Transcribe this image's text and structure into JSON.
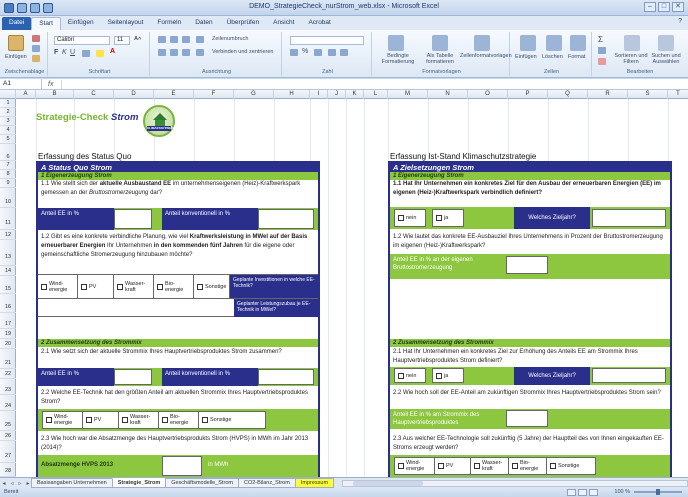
{
  "window": {
    "title": "DEMO_StrategieCheck_nurStrom_web.xlsx - Microsoft Excel",
    "minimize": "–",
    "maximize": "□",
    "close": "✕"
  },
  "ribbon_tabs": [
    "Datei",
    "Start",
    "Einfügen",
    "Seitenlayout",
    "Formeln",
    "Daten",
    "Überprüfen",
    "Ansicht",
    "Acrobat"
  ],
  "ribbon": {
    "paste_label": "Einfügen",
    "font_name": "Calibri",
    "font_size": "11",
    "groups": [
      "Zwischenablage",
      "Schriftart",
      "Ausrichtung",
      "Zahl",
      "Formatvorlagen",
      "Zellen",
      "Bearbeiten"
    ],
    "wrap_text": "Zeilenumbruch",
    "merge_center": "Verbinden und zentrieren",
    "cond_format": "Bedingte Formatierung",
    "as_table": "Als Tabelle formatieren",
    "cell_styles": "Zellenformatvorlagen",
    "insert": "Einfügen",
    "delete": "Löschen",
    "format": "Format",
    "sort_filter": "Sortieren und Filtern",
    "find_select": "Suchen und Auswählen"
  },
  "formula_bar": {
    "name_box": "A1",
    "fx": "fx",
    "value": ""
  },
  "columns": [
    "A",
    "B",
    "C",
    "D",
    "E",
    "F",
    "G",
    "H",
    "I",
    "J",
    "K",
    "L",
    "M",
    "N",
    "O",
    "P",
    "Q",
    "R",
    "S",
    "T"
  ],
  "rows": [
    "1",
    "2",
    "3",
    "4",
    "5",
    "6",
    "7",
    "8",
    "9",
    "10",
    "11",
    "12",
    "13",
    "14",
    "15",
    "16",
    "17",
    "19",
    "20",
    "21",
    "22",
    "23",
    "24",
    "25",
    "26",
    "27",
    "28"
  ],
  "sheet": {
    "title_main": "Strategie-Check ",
    "title_strom": "Strom",
    "logo_text": "KLIMASTADTWERK",
    "left": {
      "section_title": "Erfassung des Status Quo",
      "panel_title": "A Status Quo Strom",
      "g1": "1 Eigenerzeugung Strom",
      "q11_a": "1.1 Wie stellt sich der ",
      "q11_b": "aktuelle Ausbaustand EE",
      "q11_c": " im unternehmenseigenen (Heiz)-Kraftwerkspark gemessen an der ",
      "q11_d": "Bruttostromerzeugung",
      "q11_e": " dar?",
      "anteil_ee": "Anteil EE in %",
      "anteil_konv": "Anteil konventionell in %",
      "q12_a": "1.2 Gibt es eine konkrete verbindliche Planung, wie viel ",
      "q12_b": "Kraftwerksleistung in MWel auf der Basis erneuerbarer Energien",
      "q12_c": " Ihr Unternehmen ",
      "q12_d": "in den kommenden fünf Jahren",
      "q12_e": " für die eigene oder gemeinschaftliche Stromerzeugung hinzubauen möchte?",
      "checks": [
        "Wind-energie",
        "PV",
        "Wasser-kraft",
        "Bio-energie",
        "Sonstige"
      ],
      "planned_invest": "Geplante Investitionen in welche EE-Technik?",
      "planned_capacity": "Geplanter Leistungszubau je EE-Technik in MWel?",
      "g2": "2 Zusammensetzung des Strommix",
      "q21": "2.1 Wie setzt sich der aktuelle Strommix Ihres Hauptvertriebsproduktes Strom zusammen?",
      "q22": "2.2 Welche EE-Technik hat den größten Anteil am aktuellen Strommix Ihres Hauptvertriebsproduktes Strom?",
      "q23": "2.3 Wie hoch war die Absatzmenge des Hauptvertriebsprodukts Strom (HVPS) in MWh im Jahr 2013 (2014)?",
      "absatz_label": "Absatzmenge HVPS 2013",
      "unit_mwh": "in MWh"
    },
    "right": {
      "section_title": "Erfassung Ist-Stand Klimaschutzstrategie",
      "panel_title": "A Zielsetzungen Strom",
      "g1": "1 Eigenerzeugung Strom",
      "q11": "1.1 Hat Ihr Unternehmen ein konkretes Ziel für den Ausbau der erneuerbaren Energien (EE) im eigenen (Heiz-)Kraftwerkspark verbindlich definiert?",
      "nein": "nein",
      "ja": "ja",
      "which_year": "Welches Zieljahr?",
      "q12": "1.2 Wie lautet das konkrete EE-Ausbauziel Ihres Unternehmens in Prozent der Bruttostromerzeugung im eigenen (Heiz-)Kraftwerkspark?",
      "anteil_ee_own": "Anteil EE in % an der eigenen Bruttostromerzeugung",
      "g2": "2 Zusammensetzung des Strommix",
      "q21": "2.1 Hat Ihr Unternehmen ein konkretes Ziel zur Erhöhung des Anteils EE am Strommix Ihres Hauptvertriebsproduktes Strom definiert?",
      "q22": "2.2 Wie hoch soll der EE-Anteil am zukünftigen Strommix Ihres Hauptvertriebsproduktes Strom sein?",
      "anteil_ee_mix": "Anteil EE in % am Strommix des Hauptvertriebsproduktes",
      "q23": "2.3 Aus welcher EE-Technologie soll zukünftig (5 Jahre) der Hauptteil des von Ihnen eingekauften EE-Stroms erzeugt werden?"
    }
  },
  "sheet_tabs": [
    "Basisangaben Unternehmen",
    "Strategie_Strom",
    "Geschäftsmodelle_Strom",
    "CO2-Bilanz_Strom",
    "Impressum"
  ],
  "status": {
    "ready": "Bereit",
    "zoom": "100 %"
  },
  "colors": {
    "navy": "#2a2f8c",
    "green": "#8dc63f",
    "title_green": "#78b52d"
  }
}
